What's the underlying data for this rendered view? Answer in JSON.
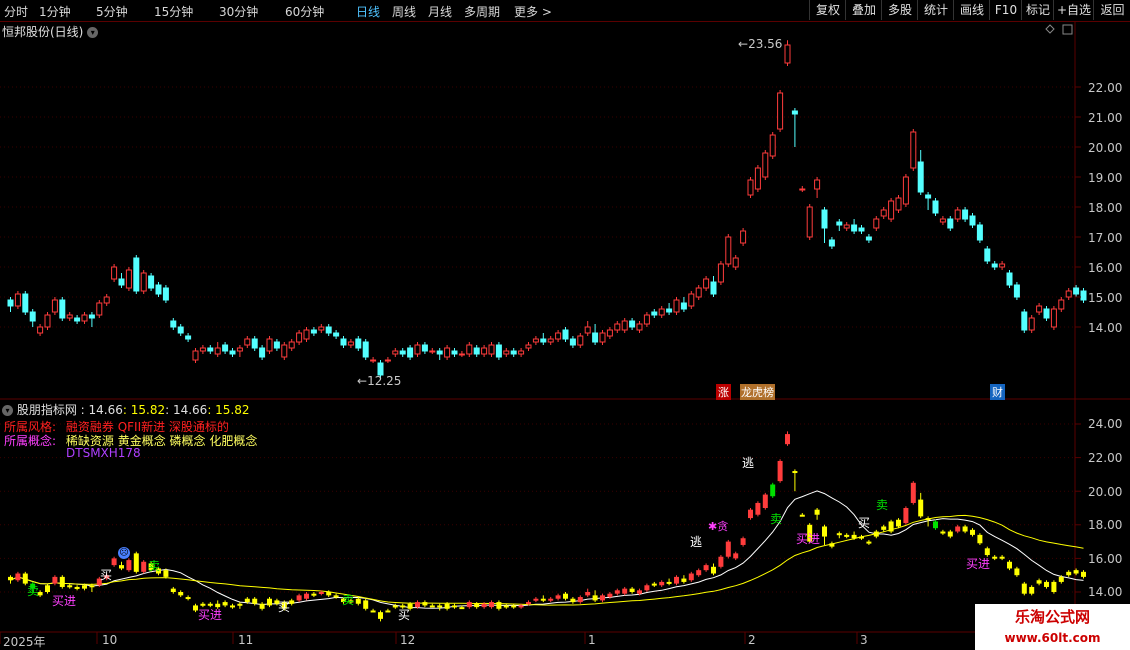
{
  "toolbar": {
    "timeframes": [
      "分时",
      "1分钟",
      "5分钟",
      "15分钟",
      "30分钟",
      "60分钟",
      "日线",
      "周线",
      "月线",
      "多周期",
      "更多 >"
    ],
    "active": "日线",
    "buttons": [
      "复权",
      "叠加",
      "多股",
      "统计",
      "画线",
      "F10",
      "标记",
      "+自选",
      "返回"
    ]
  },
  "main_panel": {
    "title": "恒邦股份(日线)",
    "high_label": "23.56",
    "low_label": "12.25",
    "price_axis": [
      "22.00",
      "21.00",
      "20.00",
      "19.00",
      "18.00",
      "17.00",
      "16.00",
      "15.00",
      "14.00"
    ],
    "markers": {
      "zhang": "涨",
      "longhu": "龙虎榜",
      "cai": "财"
    }
  },
  "indicator_panel": {
    "title": "股朋指标网",
    "values": [
      " : 14.66",
      ": 15.82",
      ": 14.66",
      ": 15.82"
    ],
    "style_label": "所属风格:",
    "style_value": "融资融券 QFII新进 深股通标的",
    "concept_label": "所属概念:",
    "concept_value": "稀缺资源 黄金概念 磷概念 化肥概念",
    "code": "DTSMXH178",
    "axis": [
      "24.00",
      "22.00",
      "20.00",
      "18.00",
      "16.00",
      "14.00"
    ],
    "signals": {
      "buy": "买",
      "sell": "卖",
      "buyin": "买进",
      "escape": "逃",
      "greedy": "贪"
    }
  },
  "x_axis": [
    "2025年",
    "10",
    "11",
    "12",
    "1",
    "2",
    "3"
  ],
  "watermark": {
    "title": "乐淘公式网",
    "url": "www.60lt.com"
  },
  "colors": {
    "up": "#ff3c3c",
    "down": "#54ffff",
    "bg": "#000000",
    "grid": "#5a0000",
    "active": "#4fc3ff",
    "yellow": "#ffff00",
    "white": "#ffffff",
    "magenta": "#ff40ff",
    "green": "#00e000"
  },
  "chart_data": {
    "type": "candlestick",
    "price_range": [
      11.5,
      24.2
    ],
    "candles": [
      [
        14.9,
        14.7,
        15.0,
        14.5
      ],
      [
        14.7,
        15.1,
        15.2,
        14.6
      ],
      [
        15.1,
        14.5,
        15.2,
        14.4
      ],
      [
        14.5,
        14.2,
        14.6,
        14.0
      ],
      [
        13.8,
        14.0,
        14.1,
        13.7
      ],
      [
        14.0,
        14.4,
        14.5,
        13.9
      ],
      [
        14.5,
        14.9,
        15.0,
        14.4
      ],
      [
        14.9,
        14.3,
        15.0,
        14.2
      ],
      [
        14.3,
        14.4,
        14.5,
        14.2
      ],
      [
        14.3,
        14.2,
        14.4,
        14.1
      ],
      [
        14.2,
        14.4,
        14.5,
        14.1
      ],
      [
        14.4,
        14.3,
        14.5,
        14.0
      ],
      [
        14.4,
        14.8,
        14.9,
        14.3
      ],
      [
        14.8,
        15.0,
        15.1,
        14.7
      ],
      [
        15.6,
        16.0,
        16.1,
        15.5
      ],
      [
        15.6,
        15.4,
        15.8,
        15.3
      ],
      [
        15.3,
        15.9,
        16.0,
        15.2
      ],
      [
        16.3,
        15.2,
        16.4,
        15.1
      ],
      [
        15.2,
        15.8,
        15.9,
        15.1
      ],
      [
        15.7,
        15.3,
        15.8,
        15.2
      ],
      [
        15.4,
        15.1,
        15.5,
        15.0
      ],
      [
        15.3,
        14.9,
        15.4,
        14.8
      ],
      [
        14.2,
        14.0,
        14.3,
        13.9
      ],
      [
        14.0,
        13.8,
        14.1,
        13.7
      ],
      [
        13.7,
        13.6,
        13.8,
        13.5
      ],
      [
        12.9,
        13.2,
        13.3,
        12.8
      ],
      [
        13.2,
        13.3,
        13.4,
        13.1
      ],
      [
        13.3,
        13.2,
        13.4,
        13.1
      ],
      [
        13.1,
        13.3,
        13.5,
        13.0
      ],
      [
        13.4,
        13.2,
        13.5,
        13.1
      ],
      [
        13.2,
        13.1,
        13.3,
        13.0
      ],
      [
        13.2,
        13.3,
        13.4,
        13.0
      ],
      [
        13.4,
        13.6,
        13.7,
        13.3
      ],
      [
        13.6,
        13.3,
        13.7,
        13.2
      ],
      [
        13.3,
        13.0,
        13.4,
        12.9
      ],
      [
        13.2,
        13.6,
        13.7,
        13.1
      ],
      [
        13.5,
        13.3,
        13.6,
        13.2
      ],
      [
        13.0,
        13.4,
        13.5,
        12.9
      ],
      [
        13.3,
        13.5,
        13.6,
        13.2
      ],
      [
        13.5,
        13.8,
        13.9,
        13.4
      ],
      [
        13.6,
        13.9,
        14.0,
        13.5
      ],
      [
        13.9,
        13.8,
        14.0,
        13.7
      ],
      [
        13.9,
        14.0,
        14.1,
        13.8
      ],
      [
        14.0,
        13.8,
        14.1,
        13.7
      ],
      [
        13.8,
        13.7,
        13.9,
        13.6
      ],
      [
        13.6,
        13.4,
        13.7,
        13.3
      ],
      [
        13.4,
        13.5,
        13.6,
        13.3
      ],
      [
        13.6,
        13.3,
        13.7,
        13.2
      ],
      [
        13.5,
        13.0,
        13.6,
        12.9
      ],
      [
        12.9,
        12.9,
        13.0,
        12.8
      ],
      [
        12.8,
        12.4,
        12.9,
        12.25
      ],
      [
        12.9,
        12.9,
        13.0,
        12.8
      ],
      [
        13.1,
        13.2,
        13.3,
        13.0
      ],
      [
        13.2,
        13.1,
        13.3,
        13.0
      ],
      [
        13.3,
        13.0,
        13.4,
        12.9
      ],
      [
        13.1,
        13.4,
        13.5,
        13.0
      ],
      [
        13.4,
        13.2,
        13.5,
        13.1
      ],
      [
        13.2,
        13.2,
        13.3,
        13.1
      ],
      [
        13.2,
        13.1,
        13.3,
        12.9
      ],
      [
        13.0,
        13.3,
        13.4,
        12.9
      ],
      [
        13.2,
        13.1,
        13.3,
        13.0
      ],
      [
        13.1,
        13.1,
        13.2,
        13.0
      ],
      [
        13.1,
        13.4,
        13.5,
        13.0
      ],
      [
        13.3,
        13.1,
        13.4,
        13.0
      ],
      [
        13.1,
        13.3,
        13.4,
        13.0
      ],
      [
        13.1,
        13.4,
        13.5,
        13.0
      ],
      [
        13.4,
        13.0,
        13.5,
        12.9
      ],
      [
        13.1,
        13.2,
        13.3,
        13.0
      ],
      [
        13.2,
        13.1,
        13.3,
        13.0
      ],
      [
        13.1,
        13.2,
        13.3,
        13.0
      ],
      [
        13.3,
        13.4,
        13.5,
        13.2
      ],
      [
        13.5,
        13.6,
        13.7,
        13.4
      ],
      [
        13.6,
        13.5,
        13.8,
        13.4
      ],
      [
        13.5,
        13.6,
        13.7,
        13.4
      ],
      [
        13.6,
        13.8,
        13.9,
        13.5
      ],
      [
        13.9,
        13.6,
        14.0,
        13.5
      ],
      [
        13.6,
        13.4,
        13.7,
        13.3
      ],
      [
        13.4,
        13.7,
        13.8,
        13.3
      ],
      [
        13.8,
        14.0,
        14.2,
        13.7
      ],
      [
        13.8,
        13.5,
        14.1,
        13.4
      ],
      [
        13.5,
        13.8,
        13.9,
        13.4
      ],
      [
        13.7,
        13.9,
        14.0,
        13.6
      ],
      [
        13.9,
        14.1,
        14.2,
        13.8
      ],
      [
        13.9,
        14.2,
        14.3,
        13.8
      ],
      [
        14.2,
        14.0,
        14.3,
        13.9
      ],
      [
        13.9,
        14.1,
        14.2,
        13.8
      ],
      [
        14.1,
        14.4,
        14.5,
        14.0
      ],
      [
        14.5,
        14.4,
        14.6,
        14.3
      ],
      [
        14.4,
        14.6,
        14.7,
        14.3
      ],
      [
        14.6,
        14.5,
        14.8,
        14.4
      ],
      [
        14.5,
        14.9,
        15.0,
        14.4
      ],
      [
        14.8,
        14.6,
        15.0,
        14.5
      ],
      [
        14.7,
        15.1,
        15.2,
        14.6
      ],
      [
        15.0,
        15.3,
        15.4,
        14.9
      ],
      [
        15.3,
        15.6,
        15.7,
        15.2
      ],
      [
        15.5,
        15.1,
        15.7,
        15.0
      ],
      [
        15.5,
        16.1,
        16.2,
        15.4
      ],
      [
        16.1,
        17.0,
        17.1,
        16.0
      ],
      [
        16.0,
        16.3,
        16.4,
        15.9
      ],
      [
        16.8,
        17.2,
        17.3,
        16.7
      ],
      [
        18.4,
        18.9,
        19.0,
        18.3
      ],
      [
        18.6,
        19.3,
        19.4,
        18.5
      ],
      [
        19.0,
        19.8,
        19.9,
        18.9
      ],
      [
        19.7,
        20.4,
        20.5,
        19.6
      ],
      [
        20.6,
        21.8,
        21.9,
        20.5
      ],
      [
        22.8,
        23.4,
        23.56,
        22.7
      ],
      [
        21.2,
        21.1,
        21.3,
        20.0
      ],
      [
        18.6,
        18.6,
        18.7,
        18.5
      ],
      [
        17.0,
        18.0,
        18.1,
        16.9
      ],
      [
        18.6,
        18.9,
        19.0,
        18.3
      ],
      [
        17.9,
        17.3,
        18.0,
        16.8
      ],
      [
        16.9,
        16.7,
        17.0,
        16.6
      ],
      [
        17.5,
        17.4,
        17.6,
        17.2
      ],
      [
        17.3,
        17.4,
        17.5,
        17.2
      ],
      [
        17.4,
        17.2,
        17.6,
        17.1
      ],
      [
        17.3,
        17.2,
        17.4,
        17.1
      ],
      [
        17.0,
        16.9,
        17.1,
        16.8
      ],
      [
        17.3,
        17.6,
        17.7,
        17.2
      ],
      [
        17.7,
        17.9,
        18.0,
        17.6
      ],
      [
        17.6,
        18.2,
        18.3,
        17.5
      ],
      [
        17.9,
        18.3,
        18.4,
        17.8
      ],
      [
        18.1,
        19.0,
        19.1,
        18.0
      ],
      [
        19.3,
        20.5,
        20.6,
        19.2
      ],
      [
        19.5,
        18.5,
        19.9,
        18.4
      ],
      [
        18.4,
        18.3,
        18.5,
        17.9
      ],
      [
        18.2,
        17.8,
        18.3,
        17.7
      ],
      [
        17.5,
        17.6,
        17.7,
        17.4
      ],
      [
        17.6,
        17.3,
        17.7,
        17.2
      ],
      [
        17.6,
        17.9,
        18.0,
        17.5
      ],
      [
        17.9,
        17.6,
        18.0,
        17.5
      ],
      [
        17.7,
        17.4,
        17.8,
        17.3
      ],
      [
        17.4,
        16.9,
        17.5,
        16.8
      ],
      [
        16.6,
        16.2,
        16.7,
        16.1
      ],
      [
        16.1,
        16.0,
        16.2,
        15.9
      ],
      [
        16.0,
        16.1,
        16.2,
        15.9
      ],
      [
        15.8,
        15.4,
        15.9,
        15.3
      ],
      [
        15.4,
        15.0,
        15.5,
        14.9
      ],
      [
        14.5,
        13.9,
        14.6,
        13.8
      ],
      [
        13.9,
        14.3,
        14.4,
        13.8
      ],
      [
        14.5,
        14.7,
        14.8,
        14.4
      ],
      [
        14.6,
        14.3,
        14.7,
        14.2
      ],
      [
        14.0,
        14.6,
        14.7,
        13.9
      ],
      [
        14.6,
        14.9,
        15.0,
        14.5
      ],
      [
        15.0,
        15.2,
        15.3,
        14.9
      ],
      [
        15.3,
        15.1,
        15.4,
        15.0
      ],
      [
        15.2,
        14.9,
        15.3,
        14.8
      ]
    ]
  }
}
